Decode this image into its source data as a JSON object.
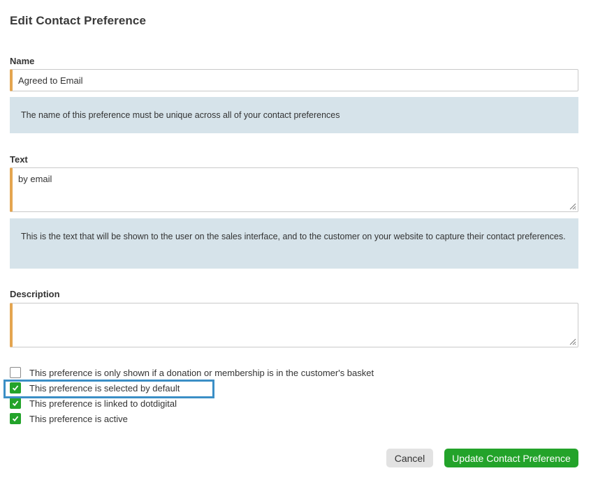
{
  "title": "Edit Contact Preference",
  "name_field": {
    "label": "Name",
    "value": "Agreed to Email",
    "hint": "The name of this preference must be unique across all of your contact preferences"
  },
  "text_field": {
    "label": "Text",
    "value": "by email",
    "hint": "This is the text that will be shown to the user on the sales interface, and to the customer on your website to capture their contact preferences."
  },
  "description_field": {
    "label": "Description",
    "value": ""
  },
  "options": [
    {
      "label": "This preference is only shown if a donation or membership is in the customer's basket",
      "checked": false
    },
    {
      "label": "This preference is selected by default",
      "checked": true
    },
    {
      "label": "This preference is linked to dotdigital",
      "checked": true
    },
    {
      "label": "This preference is active",
      "checked": true
    }
  ],
  "buttons": {
    "cancel": "Cancel",
    "update": "Update Contact Preference"
  },
  "colors": {
    "accent_border": "#e4a550",
    "hint_background": "#d6e3ea",
    "primary_button": "#23a32a",
    "highlight": "#3b8fc6"
  },
  "icons": {
    "check": "checkmark-icon",
    "resize": "resize-grip-icon"
  }
}
